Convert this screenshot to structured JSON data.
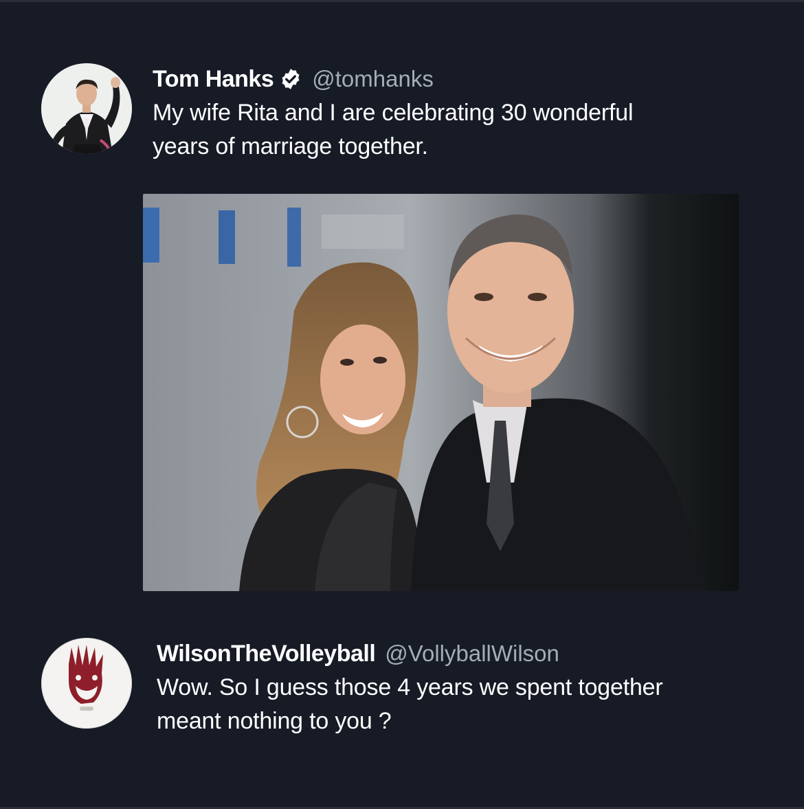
{
  "main_tweet": {
    "display_name": "Tom Hanks",
    "verified": true,
    "handle": "@tomhanks",
    "text": "My wife Rita and I are celebrating 30 wonderful years of marriage together.",
    "text_line_1": "My wife Rita and I are celebrating 30 wonderful",
    "text_line_2": "years of marriage together.",
    "avatar_icon": "person-avatar-icon",
    "photo_icon": "couple-photo-icon"
  },
  "reply_tweet": {
    "display_name": "WilsonTheVolleyball",
    "handle": "@VollyballWilson",
    "text": "Wow. So I guess those 4 years we spent together meant nothing to you ?",
    "text_line_1": "Wow. So I guess those 4 years we spent together",
    "text_line_2": "meant nothing to you ?",
    "avatar_icon": "volleyball-avatar-icon"
  },
  "colors": {
    "background": "#161b26",
    "handle": "#a5adb8",
    "verified_badge": "#ffffff",
    "text": "#ffffff"
  }
}
